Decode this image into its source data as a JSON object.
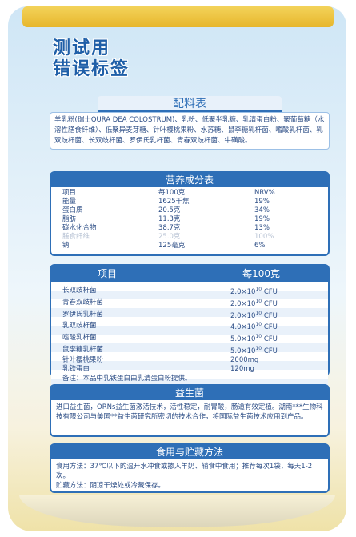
{
  "title": {
    "line1": "测试用",
    "line2": "错误标签"
  },
  "ingredients": {
    "heading": "配料表",
    "text": "羊乳粉(瑞士QURA DEA COLOSTRUM)、乳粉、低聚半乳糖、乳清蛋白粉、聚葡萄糖（水溶性膳食纤维）、低聚异麦芽糖、针叶樱桃果粉、水苏糖、鼠李糖乳杆菌、嗜酸乳杆菌、乳双歧杆菌、长双歧杆菌、罗伊氏乳杆菌、青春双歧杆菌、牛磺酸。"
  },
  "nutrition": {
    "heading": "营养成分表",
    "columns": [
      "项目",
      "每100克",
      "NRV%"
    ],
    "rows": [
      [
        "能量",
        "1625千焦",
        "19%"
      ],
      [
        "蛋白质",
        "20.5克",
        "34%"
      ],
      [
        "脂肪",
        "11.3克",
        "19%"
      ],
      [
        "碳水化合物",
        "38.7克",
        "13%"
      ],
      [
        "膳食纤维",
        "25.0克",
        "100%"
      ],
      [
        "钠",
        "125毫克",
        "6%"
      ]
    ],
    "faded_row_index": 4
  },
  "probiotics_table": {
    "col1": "项目",
    "col2": "每100克",
    "rows": [
      [
        "长双歧杆菌",
        "2.0×10",
        "10",
        "CFU"
      ],
      [
        "青春双歧杆菌",
        "2.0×10",
        "10",
        "CFU"
      ],
      [
        "罗伊氏乳杆菌",
        "2.0×10",
        "10",
        "CFU"
      ],
      [
        "乳双歧杆菌",
        "4.0×10",
        "10",
        "CFU"
      ],
      [
        "嗜酸乳杆菌",
        "5.0×10",
        "10",
        "CFU"
      ],
      [
        "鼠李糖乳杆菌",
        "5.0×10",
        "10",
        "CFU"
      ],
      [
        "针叶樱桃果粉",
        "2000mg",
        "",
        ""
      ],
      [
        "乳铁蛋白",
        "120mg",
        "",
        ""
      ]
    ],
    "note": "备注：本品中乳铁蛋白由乳清蛋白粉提供。"
  },
  "probiotic_info": {
    "heading": "益生菌",
    "text": "进口益生菌，ORNs益生菌激活技术，活性稳定，耐胃酸，肠道有效定植。湖南***生物科技有限公司与美国**益生菌研究所密切的技术合作，将国际益生菌技术应用到产品。"
  },
  "usage": {
    "heading": "食用与贮藏方法",
    "method_label": "食用方法：",
    "method_text": "37℃以下的温开水冲食或掺入羊奶、辅食中食用；推荐每次1袋，每天1-2次。",
    "storage_label": "贮藏方法：",
    "storage_text": "阴凉干燥处或冷藏保存。"
  }
}
